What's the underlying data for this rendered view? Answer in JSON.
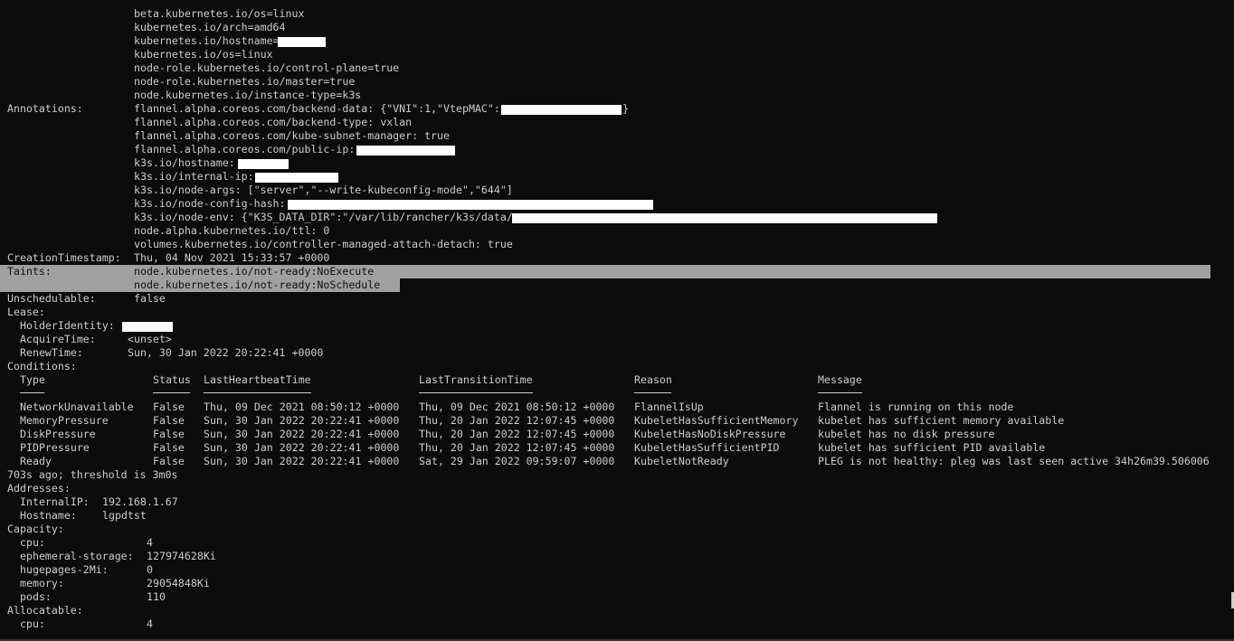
{
  "labels": {
    "node_label_beta_os": "beta.kubernetes.io/os=linux",
    "node_label_arch": "kubernetes.io/arch=amd64",
    "node_label_hostname": "kubernetes.io/hostname=",
    "node_label_os": "kubernetes.io/os=linux",
    "node_label_control_plane": "node-role.kubernetes.io/control-plane=true",
    "node_label_master": "node-role.kubernetes.io/master=true",
    "node_label_instance_type": "node.kubernetes.io/instance-type=k3s"
  },
  "annotations": {
    "key": "Annotations:",
    "backend_data_prefix": "flannel.alpha.coreos.com/backend-data: {\"VNI\":1,\"VtepMAC\":",
    "backend_data_suffix": "}",
    "backend_type": "flannel.alpha.coreos.com/backend-type: vxlan",
    "kube_subnet_manager": "flannel.alpha.coreos.com/kube-subnet-manager: true",
    "public_ip": "flannel.alpha.coreos.com/public-ip:",
    "k3s_hostname": "k3s.io/hostname:",
    "k3s_internal_ip": "k3s.io/internal-ip:",
    "k3s_node_args": "k3s.io/node-args: [\"server\",\"--write-kubeconfig-mode\",\"644\"]",
    "k3s_node_config_hash": "k3s.io/node-config-hash:",
    "k3s_node_env": "k3s.io/node-env: {\"K3S_DATA_DIR\":\"/var/lib/rancher/k3s/data/",
    "node_ttl": "node.alpha.kubernetes.io/ttl: 0",
    "controller_managed": "volumes.kubernetes.io/controller-managed-attach-detach: true"
  },
  "creation": {
    "key": "CreationTimestamp:",
    "value": "Thu, 04 Nov 2021 15:33:57 +0000"
  },
  "taints": {
    "key": "Taints:",
    "value_1": "node.kubernetes.io/not-ready:NoExecute",
    "value_2": "node.kubernetes.io/not-ready:NoSchedule"
  },
  "unschedulable": {
    "key": "Unschedulable:",
    "value": "false"
  },
  "lease": {
    "key": "Lease:",
    "holder_identity_key": "HolderIdentity:",
    "acquire_time_key": "AcquireTime:",
    "acquire_time_value": "<unset>",
    "renew_time_key": "RenewTime:",
    "renew_time_value": "Sun, 30 Jan 2022 20:22:41 +0000"
  },
  "conditions": {
    "key": "Conditions:",
    "headers": {
      "type": "Type",
      "status": "Status",
      "last_heartbeat": "LastHeartbeatTime",
      "last_transition": "LastTransitionTime",
      "reason": "Reason",
      "message": "Message"
    },
    "rows": [
      {
        "type": "NetworkUnavailable",
        "status": "False",
        "heartbeat": "Thu, 09 Dec 2021 08:50:12 +0000",
        "transition": "Thu, 09 Dec 2021 08:50:12 +0000",
        "reason": "FlannelIsUp",
        "message": "Flannel is running on this node"
      },
      {
        "type": "MemoryPressure",
        "status": "False",
        "heartbeat": "Sun, 30 Jan 2022 20:22:41 +0000",
        "transition": "Thu, 20 Jan 2022 12:07:45 +0000",
        "reason": "KubeletHasSufficientMemory",
        "message": "kubelet has sufficient memory available"
      },
      {
        "type": "DiskPressure",
        "status": "False",
        "heartbeat": "Sun, 30 Jan 2022 20:22:41 +0000",
        "transition": "Thu, 20 Jan 2022 12:07:45 +0000",
        "reason": "KubeletHasNoDiskPressure",
        "message": "kubelet has no disk pressure"
      },
      {
        "type": "PIDPressure",
        "status": "False",
        "heartbeat": "Sun, 30 Jan 2022 20:22:41 +0000",
        "transition": "Thu, 20 Jan 2022 12:07:45 +0000",
        "reason": "KubeletHasSufficientPID",
        "message": "kubelet has sufficient PID available"
      },
      {
        "type": "Ready",
        "status": "False",
        "heartbeat": "Sun, 30 Jan 2022 20:22:41 +0000",
        "transition": "Sat, 29 Jan 2022 09:59:07 +0000",
        "reason": "KubeletNotReady",
        "message": "PLEG is not healthy: pleg was last seen active 34h26m39.506006"
      }
    ],
    "ready_message_wrap": "703s ago; threshold is 3m0s"
  },
  "addresses": {
    "key": "Addresses:",
    "internal_ip_key": "InternalIP:",
    "internal_ip_value": "192.168.1.67",
    "hostname_key": "Hostname:",
    "hostname_value": "lgpdtst"
  },
  "capacity": {
    "key": "Capacity:",
    "cpu_key": "cpu:",
    "cpu_value": "4",
    "ephemeral_storage_key": "ephemeral-storage:",
    "ephemeral_storage_value": "127974628Ki",
    "hugepages_key": "hugepages-2Mi:",
    "hugepages_value": "0",
    "memory_key": "memory:",
    "memory_value": "29054848Ki",
    "pods_key": "pods:",
    "pods_value": "110"
  },
  "allocatable": {
    "key": "Allocatable:",
    "cpu_key": "cpu:",
    "cpu_value": "4"
  },
  "colors": {
    "background": "#0c0c0c",
    "foreground": "#cccccc",
    "selection": "#a0a0a0",
    "redaction": "#ffffff"
  }
}
